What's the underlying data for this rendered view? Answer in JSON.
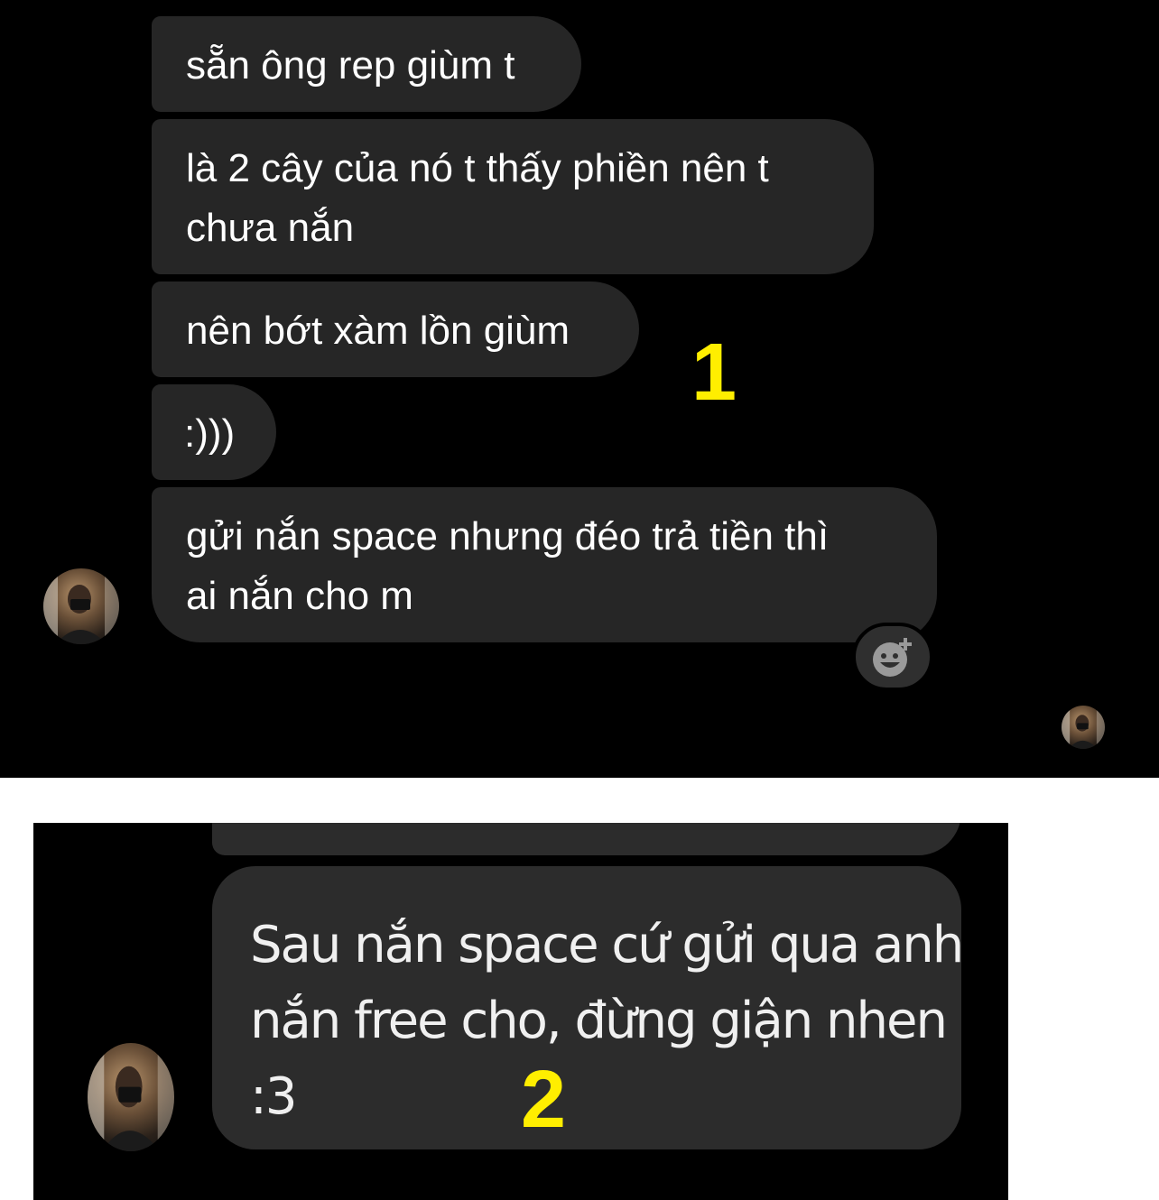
{
  "panel1": {
    "messages": [
      {
        "line1": "sẵn ông rep giùm t"
      },
      {
        "line1": "là 2 cây của nó t thấy phiền nên t",
        "line2": "chưa nắn"
      },
      {
        "line1": "nên bớt xàm lồn giùm"
      },
      {
        "line1": ":)))"
      },
      {
        "line1": "gửi nắn space nhưng đéo trả tiền thì",
        "line2": "ai nắn cho m"
      }
    ],
    "marker": "1",
    "react_icon": "add-reaction-icon"
  },
  "panel2": {
    "message": {
      "line1": "Sau nắn space cứ gửi qua anh",
      "line2": "nắn free cho, đừng giận nhen",
      "line3": ":3"
    },
    "marker": "2"
  },
  "colors": {
    "background": "#000000",
    "bubble": "#262626",
    "text": "#ffffff",
    "marker": "#ffee00",
    "separator": "#ffffff"
  }
}
